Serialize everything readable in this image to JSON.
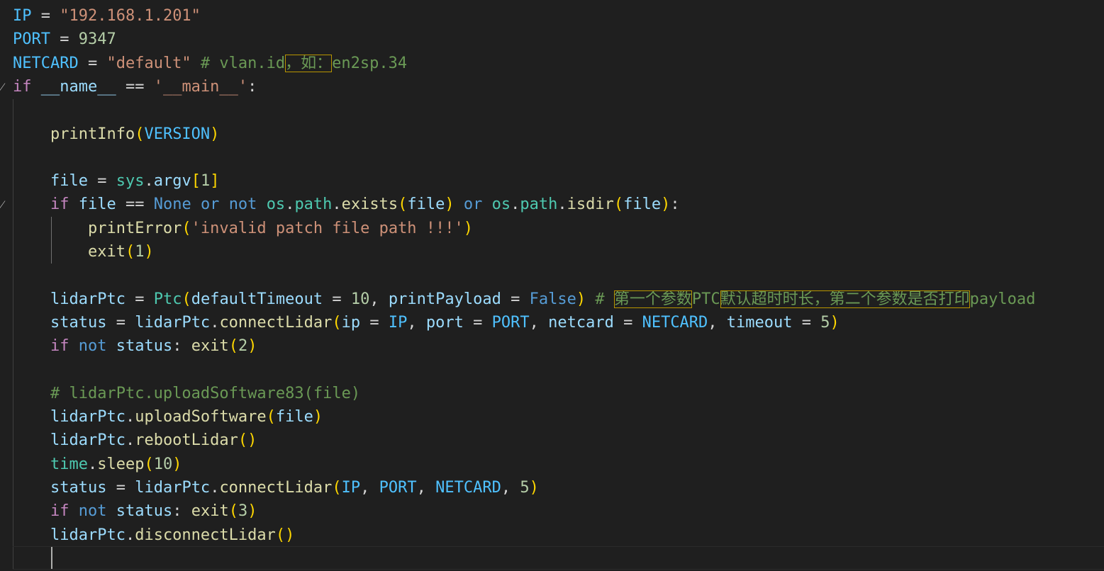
{
  "editor": {
    "lines": [
      {
        "fold": "",
        "tokens": [
          {
            "t": "IP",
            "c": "c-const"
          },
          {
            "t": " = ",
            "c": "c-op"
          },
          {
            "t": "\"192.168.1.201\"",
            "c": "c-str"
          }
        ]
      },
      {
        "fold": "",
        "tokens": [
          {
            "t": "PORT",
            "c": "c-const"
          },
          {
            "t": " = ",
            "c": "c-op"
          },
          {
            "t": "9347",
            "c": "c-num"
          }
        ]
      },
      {
        "fold": "",
        "tokens": [
          {
            "t": "NETCARD",
            "c": "c-const"
          },
          {
            "t": " = ",
            "c": "c-op"
          },
          {
            "t": "\"default\"",
            "c": "c-str"
          },
          {
            "t": " # vlan.id",
            "c": "c-cmt"
          },
          {
            "t": "，如：",
            "c": "c-cmt",
            "hl": true
          },
          {
            "t": "en2sp.34",
            "c": "c-cmt"
          }
        ]
      },
      {
        "fold": "⁄",
        "tokens": [
          {
            "t": "if",
            "c": "c-kw"
          },
          {
            "t": " ",
            "c": "c-op"
          },
          {
            "t": "__name__",
            "c": "c-var"
          },
          {
            "t": " == ",
            "c": "c-op"
          },
          {
            "t": "'__main__'",
            "c": "c-str"
          },
          {
            "t": ":",
            "c": "c-op"
          }
        ]
      },
      {
        "fold": "",
        "tokens": []
      },
      {
        "fold": "",
        "tokens": [
          {
            "t": "    ",
            "c": "c-op"
          },
          {
            "t": "printInfo",
            "c": "c-fn"
          },
          {
            "t": "(",
            "c": "c-br1"
          },
          {
            "t": "VERSION",
            "c": "c-const"
          },
          {
            "t": ")",
            "c": "c-br1"
          }
        ]
      },
      {
        "fold": "",
        "tokens": []
      },
      {
        "fold": "",
        "tokens": [
          {
            "t": "    ",
            "c": "c-op"
          },
          {
            "t": "file",
            "c": "c-var"
          },
          {
            "t": " = ",
            "c": "c-op"
          },
          {
            "t": "sys",
            "c": "c-mod"
          },
          {
            "t": ".",
            "c": "c-op"
          },
          {
            "t": "argv",
            "c": "c-var"
          },
          {
            "t": "[",
            "c": "c-br1"
          },
          {
            "t": "1",
            "c": "c-num"
          },
          {
            "t": "]",
            "c": "c-br1"
          }
        ]
      },
      {
        "fold": "⁄",
        "tokens": [
          {
            "t": "    ",
            "c": "c-op"
          },
          {
            "t": "if",
            "c": "c-kw"
          },
          {
            "t": " ",
            "c": "c-op"
          },
          {
            "t": "file",
            "c": "c-var"
          },
          {
            "t": " == ",
            "c": "c-op"
          },
          {
            "t": "None",
            "c": "c-kw2"
          },
          {
            "t": " ",
            "c": "c-op"
          },
          {
            "t": "or",
            "c": "c-kw2"
          },
          {
            "t": " ",
            "c": "c-op"
          },
          {
            "t": "not",
            "c": "c-kw2"
          },
          {
            "t": " ",
            "c": "c-op"
          },
          {
            "t": "os",
            "c": "c-mod"
          },
          {
            "t": ".",
            "c": "c-op"
          },
          {
            "t": "path",
            "c": "c-mod"
          },
          {
            "t": ".",
            "c": "c-op"
          },
          {
            "t": "exists",
            "c": "c-fn"
          },
          {
            "t": "(",
            "c": "c-br1"
          },
          {
            "t": "file",
            "c": "c-var"
          },
          {
            "t": ")",
            "c": "c-br1"
          },
          {
            "t": " ",
            "c": "c-op"
          },
          {
            "t": "or",
            "c": "c-kw2"
          },
          {
            "t": " ",
            "c": "c-op"
          },
          {
            "t": "os",
            "c": "c-mod"
          },
          {
            "t": ".",
            "c": "c-op"
          },
          {
            "t": "path",
            "c": "c-mod"
          },
          {
            "t": ".",
            "c": "c-op"
          },
          {
            "t": "isdir",
            "c": "c-fn"
          },
          {
            "t": "(",
            "c": "c-br1"
          },
          {
            "t": "file",
            "c": "c-var"
          },
          {
            "t": ")",
            "c": "c-br1"
          },
          {
            "t": ":",
            "c": "c-op"
          }
        ]
      },
      {
        "fold": "",
        "tokens": [
          {
            "t": "        ",
            "c": "c-op"
          },
          {
            "t": "printError",
            "c": "c-fn"
          },
          {
            "t": "(",
            "c": "c-br1"
          },
          {
            "t": "'invalid patch file path !!!'",
            "c": "c-str"
          },
          {
            "t": ")",
            "c": "c-br1"
          }
        ]
      },
      {
        "fold": "",
        "tokens": [
          {
            "t": "        ",
            "c": "c-op"
          },
          {
            "t": "exit",
            "c": "c-fn"
          },
          {
            "t": "(",
            "c": "c-br1"
          },
          {
            "t": "1",
            "c": "c-num"
          },
          {
            "t": ")",
            "c": "c-br1"
          }
        ]
      },
      {
        "fold": "",
        "tokens": []
      },
      {
        "fold": "",
        "tokens": [
          {
            "t": "    ",
            "c": "c-op"
          },
          {
            "t": "lidarPtc",
            "c": "c-var"
          },
          {
            "t": " = ",
            "c": "c-op"
          },
          {
            "t": "Ptc",
            "c": "c-mod"
          },
          {
            "t": "(",
            "c": "c-br1"
          },
          {
            "t": "defaultTimeout",
            "c": "c-var"
          },
          {
            "t": " = ",
            "c": "c-op"
          },
          {
            "t": "10",
            "c": "c-num"
          },
          {
            "t": ", ",
            "c": "c-op"
          },
          {
            "t": "printPayload",
            "c": "c-var"
          },
          {
            "t": " = ",
            "c": "c-op"
          },
          {
            "t": "False",
            "c": "c-kw2"
          },
          {
            "t": ")",
            "c": "c-br1"
          },
          {
            "t": " # ",
            "c": "c-cmt"
          },
          {
            "t": "第一个参数",
            "c": "c-cmt",
            "hl": true
          },
          {
            "t": "PTC",
            "c": "c-cmt"
          },
          {
            "t": "默认超时时长，第二个参数是否打印",
            "c": "c-cmt",
            "hl": true
          },
          {
            "t": "payload",
            "c": "c-cmt"
          }
        ]
      },
      {
        "fold": "",
        "tokens": [
          {
            "t": "    ",
            "c": "c-op"
          },
          {
            "t": "status",
            "c": "c-var"
          },
          {
            "t": " = ",
            "c": "c-op"
          },
          {
            "t": "lidarPtc",
            "c": "c-var"
          },
          {
            "t": ".",
            "c": "c-op"
          },
          {
            "t": "connectLidar",
            "c": "c-fn"
          },
          {
            "t": "(",
            "c": "c-br1"
          },
          {
            "t": "ip",
            "c": "c-var"
          },
          {
            "t": " = ",
            "c": "c-op"
          },
          {
            "t": "IP",
            "c": "c-const"
          },
          {
            "t": ", ",
            "c": "c-op"
          },
          {
            "t": "port",
            "c": "c-var"
          },
          {
            "t": " = ",
            "c": "c-op"
          },
          {
            "t": "PORT",
            "c": "c-const"
          },
          {
            "t": ", ",
            "c": "c-op"
          },
          {
            "t": "netcard",
            "c": "c-var"
          },
          {
            "t": " = ",
            "c": "c-op"
          },
          {
            "t": "NETCARD",
            "c": "c-const"
          },
          {
            "t": ", ",
            "c": "c-op"
          },
          {
            "t": "timeout",
            "c": "c-var"
          },
          {
            "t": " = ",
            "c": "c-op"
          },
          {
            "t": "5",
            "c": "c-num"
          },
          {
            "t": ")",
            "c": "c-br1"
          }
        ]
      },
      {
        "fold": "",
        "tokens": [
          {
            "t": "    ",
            "c": "c-op"
          },
          {
            "t": "if",
            "c": "c-kw"
          },
          {
            "t": " ",
            "c": "c-op"
          },
          {
            "t": "not",
            "c": "c-kw2"
          },
          {
            "t": " ",
            "c": "c-op"
          },
          {
            "t": "status",
            "c": "c-var"
          },
          {
            "t": ": ",
            "c": "c-op"
          },
          {
            "t": "exit",
            "c": "c-fn"
          },
          {
            "t": "(",
            "c": "c-br1"
          },
          {
            "t": "2",
            "c": "c-num"
          },
          {
            "t": ")",
            "c": "c-br1"
          }
        ]
      },
      {
        "fold": "",
        "tokens": []
      },
      {
        "fold": "",
        "tokens": [
          {
            "t": "    ",
            "c": "c-op"
          },
          {
            "t": "# lidarPtc.uploadSoftware83(file)",
            "c": "c-cmt"
          }
        ]
      },
      {
        "fold": "",
        "tokens": [
          {
            "t": "    ",
            "c": "c-op"
          },
          {
            "t": "lidarPtc",
            "c": "c-var"
          },
          {
            "t": ".",
            "c": "c-op"
          },
          {
            "t": "uploadSoftware",
            "c": "c-fn"
          },
          {
            "t": "(",
            "c": "c-br1"
          },
          {
            "t": "file",
            "c": "c-var"
          },
          {
            "t": ")",
            "c": "c-br1"
          }
        ]
      },
      {
        "fold": "",
        "tokens": [
          {
            "t": "    ",
            "c": "c-op"
          },
          {
            "t": "lidarPtc",
            "c": "c-var"
          },
          {
            "t": ".",
            "c": "c-op"
          },
          {
            "t": "rebootLidar",
            "c": "c-fn"
          },
          {
            "t": "()",
            "c": "c-br1"
          }
        ]
      },
      {
        "fold": "",
        "tokens": [
          {
            "t": "    ",
            "c": "c-op"
          },
          {
            "t": "time",
            "c": "c-mod"
          },
          {
            "t": ".",
            "c": "c-op"
          },
          {
            "t": "sleep",
            "c": "c-fn"
          },
          {
            "t": "(",
            "c": "c-br1"
          },
          {
            "t": "10",
            "c": "c-num"
          },
          {
            "t": ")",
            "c": "c-br1"
          }
        ]
      },
      {
        "fold": "",
        "tokens": [
          {
            "t": "    ",
            "c": "c-op"
          },
          {
            "t": "status",
            "c": "c-var"
          },
          {
            "t": " = ",
            "c": "c-op"
          },
          {
            "t": "lidarPtc",
            "c": "c-var"
          },
          {
            "t": ".",
            "c": "c-op"
          },
          {
            "t": "connectLidar",
            "c": "c-fn"
          },
          {
            "t": "(",
            "c": "c-br1"
          },
          {
            "t": "IP",
            "c": "c-const"
          },
          {
            "t": ", ",
            "c": "c-op"
          },
          {
            "t": "PORT",
            "c": "c-const"
          },
          {
            "t": ", ",
            "c": "c-op"
          },
          {
            "t": "NETCARD",
            "c": "c-const"
          },
          {
            "t": ", ",
            "c": "c-op"
          },
          {
            "t": "5",
            "c": "c-num"
          },
          {
            "t": ")",
            "c": "c-br1"
          }
        ]
      },
      {
        "fold": "",
        "tokens": [
          {
            "t": "    ",
            "c": "c-op"
          },
          {
            "t": "if",
            "c": "c-kw"
          },
          {
            "t": " ",
            "c": "c-op"
          },
          {
            "t": "not",
            "c": "c-kw2"
          },
          {
            "t": " ",
            "c": "c-op"
          },
          {
            "t": "status",
            "c": "c-var"
          },
          {
            "t": ": ",
            "c": "c-op"
          },
          {
            "t": "exit",
            "c": "c-fn"
          },
          {
            "t": "(",
            "c": "c-br1"
          },
          {
            "t": "3",
            "c": "c-num"
          },
          {
            "t": ")",
            "c": "c-br1"
          }
        ]
      },
      {
        "fold": "",
        "tokens": [
          {
            "t": "    ",
            "c": "c-op"
          },
          {
            "t": "lidarPtc",
            "c": "c-var"
          },
          {
            "t": ".",
            "c": "c-op"
          },
          {
            "t": "disconnectLidar",
            "c": "c-fn"
          },
          {
            "t": "()",
            "c": "c-br1"
          }
        ]
      },
      {
        "fold": "",
        "tokens": []
      }
    ],
    "colors": {
      "background": "#1f1f1f",
      "highlight_border": "#b89500"
    }
  }
}
